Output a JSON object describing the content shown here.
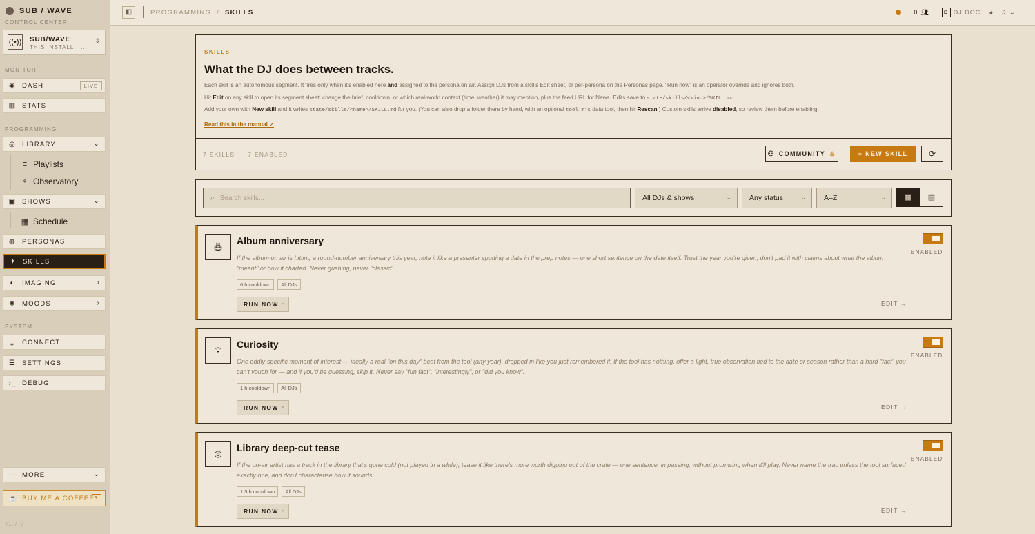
{
  "sidebar": {
    "brand_title": "SUB / WAVE",
    "brand_subtitle": "CONTROL CENTER",
    "install": {
      "title": "SUB/WAVE",
      "subtitle": "THIS INSTALL · ..."
    },
    "sections": {
      "monitor": "MONITOR",
      "programming": "PROGRAMMING",
      "system": "SYSTEM"
    },
    "items": {
      "dash": "DASH",
      "dash_badge": "LIVE",
      "stats": "STATS",
      "library": "LIBRARY",
      "playlists": "Playlists",
      "observatory": "Observatory",
      "shows": "SHOWS",
      "schedule": "Schedule",
      "personas": "PERSONAS",
      "skills": "SKILLS",
      "imaging": "IMAGING",
      "moods": "MOODS",
      "connect": "CONNECT",
      "settings": "SETTINGS",
      "debug": "DEBUG",
      "more": "MORE"
    },
    "coffee": "BUY ME A COFFEE",
    "version": "v1.7.0"
  },
  "topbar": {
    "breadcrumb_parent": "PROGRAMMING",
    "breadcrumb_sep": "/",
    "breadcrumb_current": "SKILLS",
    "listener_count": "0",
    "dj_label": "DJ DOC"
  },
  "header": {
    "eyebrow": "SKILLS",
    "title": "What the DJ does between tracks.",
    "p1": {
      "a": "Each skill is an autonomous segment. It fires only when it's enabled here ",
      "b": "and",
      "c": " assigned to the persona on air. Assign DJs from a skill's Edit sheet, or per-persona on the Personas page. \"Run now\" is an operator override and ignores both."
    },
    "p2": {
      "a": "Hit ",
      "b": "Edit",
      "c": " on any skill to open its segment sheet: change the brief, cooldown, or which real-world context (time, weather) it may mention, plus the feed URL for News. Edits save to ",
      "code": "state/skills/<kind>/SKILL.md",
      "d": "."
    },
    "p3": {
      "a": "Add your own with ",
      "b": "New skill",
      "c": " and it writes ",
      "code1": "state/skills/<name>/SKILL.md",
      "d": " for you. (You can also drop a folder there by hand, with an optional ",
      "code2": "tool.mjs",
      "e": " data tool, then hit ",
      "f": "Rescan",
      "g": ".) Custom skills arrive ",
      "h": "disabled",
      "i": ", so review them before enabling."
    },
    "manual_link": "Read this in the manual ↗",
    "count_skills": "7 SKILLS",
    "count_enabled": "7 ENABLED",
    "community_button": "COMMUNITY",
    "new_skill_button": "+ NEW SKILL"
  },
  "filters": {
    "search_placeholder": "Search skills...",
    "dj_filter": "All DJs & shows",
    "status_filter": "Any status",
    "sort": "A–Z"
  },
  "skills": [
    {
      "title": "Album anniversary",
      "description": "If the album on air is hitting a round-number anniversary this year, note it like a presenter spotting a date in the prep notes — one short sentence on the date itself. Trust the year you're given; don't pad it with claims about what the album \"meant\" or how it charted. Never gushing, never \"classic\".",
      "cooldown": "6 h cooldown",
      "djs": "All DJs",
      "run_label": "RUN NOW",
      "edit_label": "EDIT →",
      "status": "ENABLED",
      "enabled": true,
      "icon": "cake-icon"
    },
    {
      "title": "Curiosity",
      "description": "One oddly-specific moment of interest — ideally a real \"on this day\" beat from the tool (any year), dropped in like you just remembered it. If the tool has nothing, offer a light, true observation tied to the date or season rather than a hard \"fact\" you can't vouch for — and if you'd be guessing, skip it. Never say \"fun fact\", \"interestingly\", or \"did you know\".",
      "cooldown": "1 h cooldown",
      "djs": "All DJs",
      "run_label": "RUN NOW",
      "edit_label": "EDIT →",
      "status": "ENABLED",
      "enabled": true,
      "icon": "lightbulb-icon"
    },
    {
      "title": "Library deep-cut tease",
      "description": "If the on-air artist has a track in the library that's gone cold (not played in a while), tease it like there's more worth digging out of the crate — one sentence, in passing, without promising when it'll play. Never name the trac unless the tool surfaced exactly one, and don't characterise how it sounds.",
      "cooldown": "1.5 h cooldown",
      "djs": "All DJs",
      "run_label": "RUN NOW",
      "edit_label": "EDIT →",
      "status": "ENABLED",
      "enabled": true,
      "icon": "vinyl-icon"
    }
  ],
  "colors": {
    "accent": "#c77a12",
    "background": "#e9e0cf",
    "card": "#efe7d9",
    "ink": "#2a1f17"
  }
}
